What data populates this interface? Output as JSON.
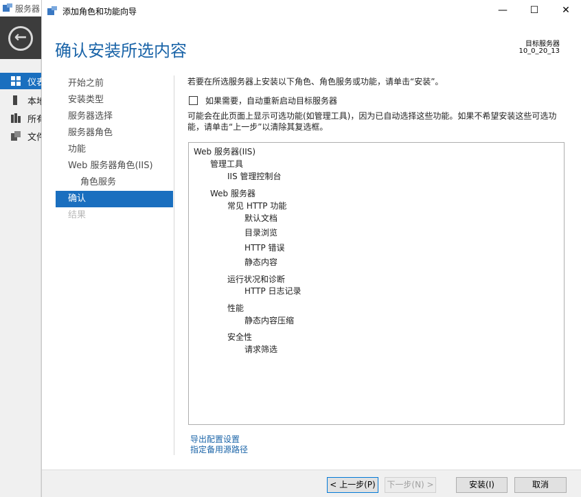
{
  "background": {
    "title": "服务器",
    "side_items": [
      "仪表",
      "本地",
      "所有",
      "文件"
    ]
  },
  "window": {
    "title": "添加角色和功能向导",
    "min_symbol": "—",
    "max_symbol": "☐",
    "close_symbol": "✕"
  },
  "header": {
    "page_title": "确认安装所选内容",
    "target_label": "目标服务器",
    "target_name": "10_0_20_13"
  },
  "steps": [
    {
      "label": "开始之前",
      "state": "normal"
    },
    {
      "label": "安装类型",
      "state": "normal"
    },
    {
      "label": "服务器选择",
      "state": "normal"
    },
    {
      "label": "服务器角色",
      "state": "normal"
    },
    {
      "label": "功能",
      "state": "normal"
    },
    {
      "label": "Web 服务器角色(IIS)",
      "state": "normal"
    },
    {
      "label": "角色服务",
      "state": "sub"
    },
    {
      "label": "确认",
      "state": "current"
    },
    {
      "label": "结果",
      "state": "disabled"
    }
  ],
  "content": {
    "instruction": "若要在所选服务器上安装以下角色、角色服务或功能，请单击“安装”。",
    "restart_label": "如果需要，自动重新启动目标服务器",
    "restart_checked": false,
    "note": "可能会在此页面上显示可选功能(如管理工具)，因为已自动选择这些功能。如果不希望安装这些可选功能，请单击“上一步”以清除其复选框。"
  },
  "install_list": [
    {
      "text": "Web 服务器(IIS)",
      "level": 0
    },
    {
      "text": "管理工具",
      "level": 1
    },
    {
      "text": "IIS 管理控制台",
      "level": 2
    },
    {
      "text": "Web 服务器",
      "level": 1
    },
    {
      "text": "常见 HTTP 功能",
      "level": 2
    },
    {
      "text": "默认文档",
      "level": 3
    },
    {
      "text": "目录浏览",
      "level": 3
    },
    {
      "text": "HTTP 错误",
      "level": 3
    },
    {
      "text": "静态内容",
      "level": 3
    },
    {
      "text": "运行状况和诊断",
      "level": 2
    },
    {
      "text": "HTTP 日志记录",
      "level": 3
    },
    {
      "text": "性能",
      "level": 2
    },
    {
      "text": "静态内容压缩",
      "level": 3
    },
    {
      "text": "安全性",
      "level": 2
    },
    {
      "text": "请求筛选",
      "level": 3
    }
  ],
  "links": {
    "export": "导出配置设置",
    "alt_source": "指定备用源路径"
  },
  "footer": {
    "prev": "< 上一步(P)",
    "next": "下一步(N) >",
    "install": "安装(I)",
    "cancel": "取消"
  },
  "colors": {
    "accent": "#1a6fbf",
    "title_blue": "#1a64a8"
  }
}
